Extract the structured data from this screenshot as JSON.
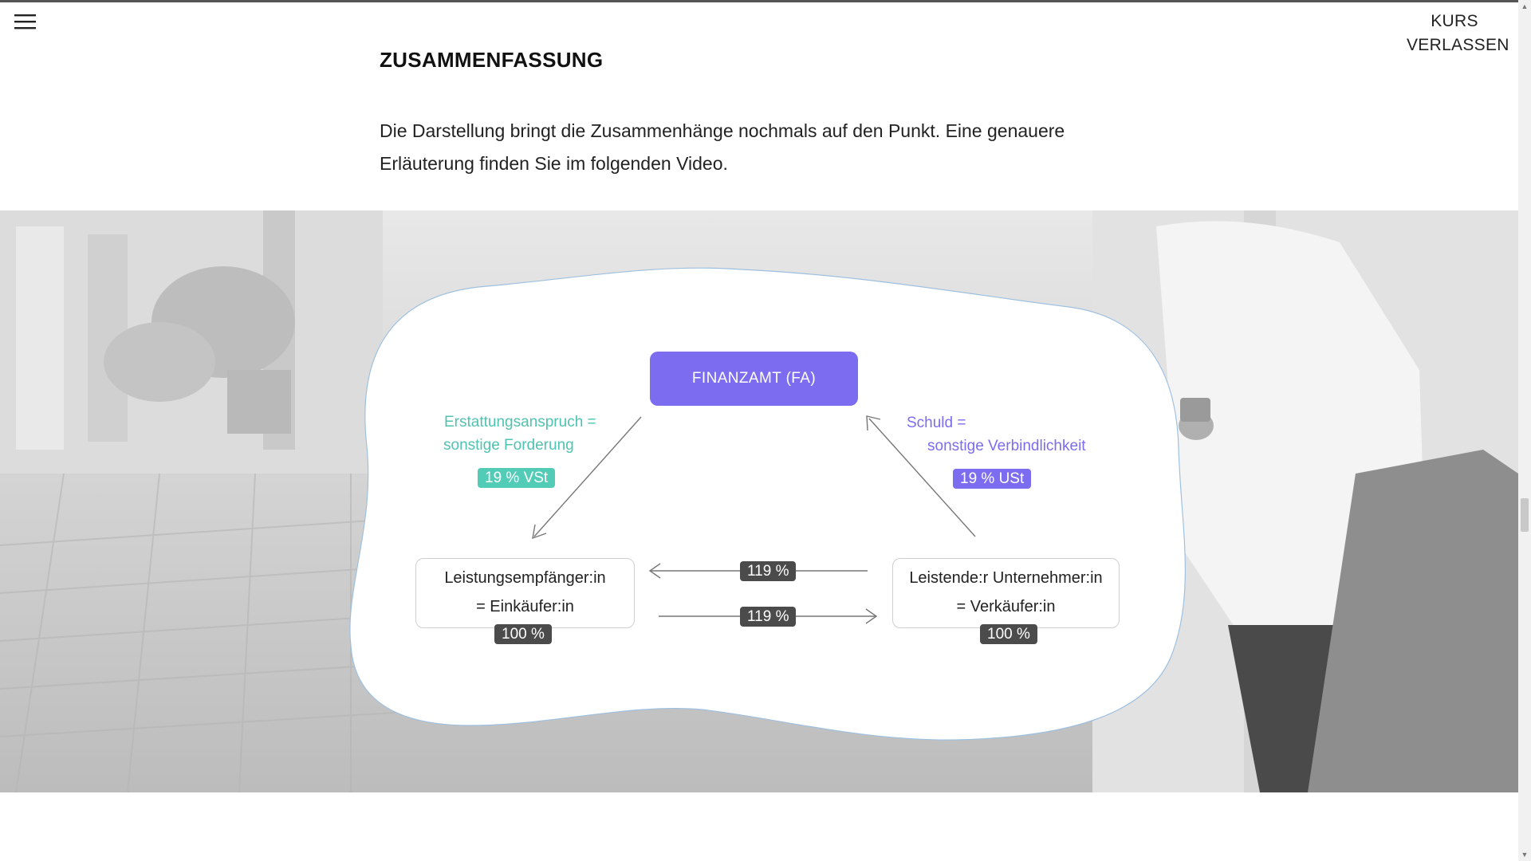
{
  "header": {
    "menu_icon": "hamburger-menu-icon",
    "exit_line1": "KURS",
    "exit_line2": "VERLASSEN"
  },
  "section": {
    "title": "ZUSAMMENFASSUNG",
    "intro": "Die Darstellung bringt die Zusammenhänge nochmals auf den Punkt. Eine genauere Erläuterung finden Sie im folgenden Video."
  },
  "diagram": {
    "center": "FINANZAMT (FA)",
    "left_node": {
      "line1": "Leistungsempfänger:in",
      "line2": "= Einkäufer:in",
      "badge": "100 %"
    },
    "right_node": {
      "line1": "Leistende:r Unternehmer:in",
      "line2": "= Verkäufer:in",
      "badge": "100 %"
    },
    "left_label": {
      "line1": "Erstattungsanspruch =",
      "line2": "sonstige Forderung",
      "badge": "19 % VSt"
    },
    "right_label": {
      "line1": "Schuld =",
      "line2": "sonstige Verbindlichkeit",
      "badge": "19 % USt"
    },
    "arrow_top_badge": "119 %",
    "arrow_bottom_badge": "119 %",
    "colors": {
      "accent_purple": "#7b6cf0",
      "accent_teal": "#52cbb7",
      "badge_dark": "#4b4b4b"
    }
  },
  "scrollbar": {
    "up_icon": "scroll-up-arrow-icon",
    "down_icon": "scroll-down-arrow-icon"
  }
}
